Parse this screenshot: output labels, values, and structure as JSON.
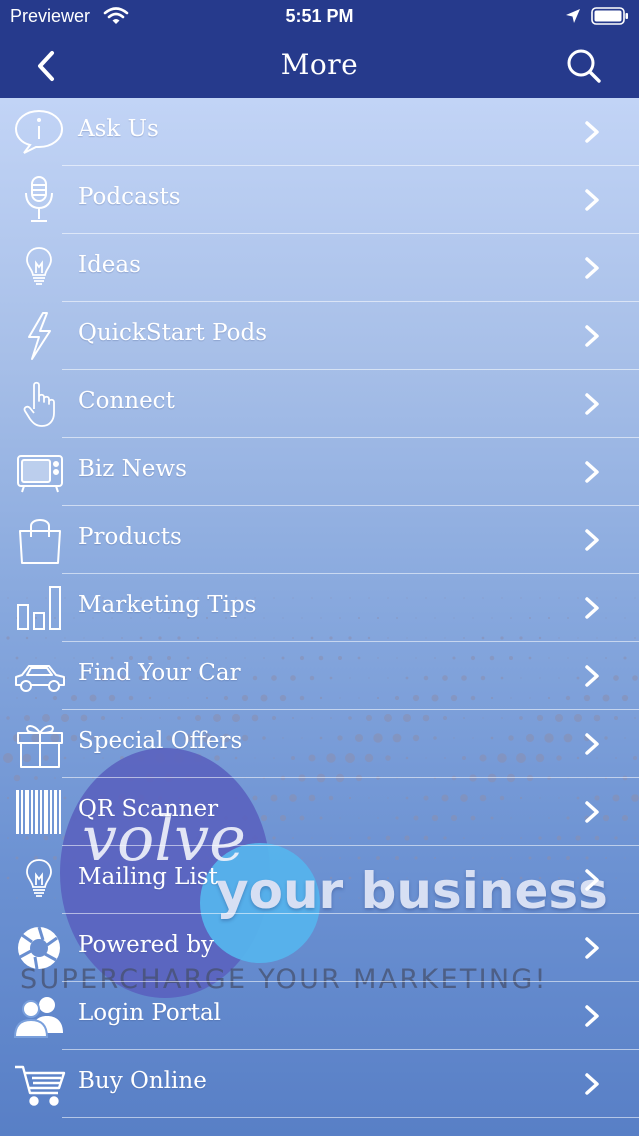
{
  "status_bar": {
    "carrier": "Previewer",
    "time": "5:51 PM",
    "icons": [
      "wifi-icon",
      "location-arrow-icon",
      "battery-icon"
    ]
  },
  "nav": {
    "title": "More",
    "back_icon": "chevron-left-icon",
    "search_icon": "search-icon"
  },
  "menu": [
    {
      "label": "Ask Us",
      "icon": "info-speech-bubble-icon"
    },
    {
      "label": "Podcasts",
      "icon": "microphone-icon"
    },
    {
      "label": "Ideas",
      "icon": "lightbulb-icon"
    },
    {
      "label": "QuickStart Pods",
      "icon": "lightning-bolt-icon"
    },
    {
      "label": "Connect",
      "icon": "pointing-hand-icon"
    },
    {
      "label": "Biz News",
      "icon": "tv-icon"
    },
    {
      "label": "Products",
      "icon": "shopping-bag-icon"
    },
    {
      "label": "Marketing Tips",
      "icon": "bar-chart-icon"
    },
    {
      "label": "Find Your Car",
      "icon": "car-icon"
    },
    {
      "label": "Special Offers",
      "icon": "gift-icon"
    },
    {
      "label": "QR Scanner",
      "icon": "barcode-icon"
    },
    {
      "label": "Mailing List",
      "icon": "lightbulb-icon"
    },
    {
      "label": "Powered by",
      "icon": "aperture-icon"
    },
    {
      "label": "Login Portal",
      "icon": "users-icon"
    },
    {
      "label": "Buy Online",
      "icon": "shopping-cart-icon"
    }
  ],
  "branding": {
    "line1": "volve",
    "line2": "your business",
    "tagline": "SUPERCHARGE YOUR MARKETING!"
  },
  "colors": {
    "nav_background": "#263a8c",
    "content_top": "#c2d4f6",
    "content_bottom": "#587fc6",
    "text": "#ffffff"
  }
}
